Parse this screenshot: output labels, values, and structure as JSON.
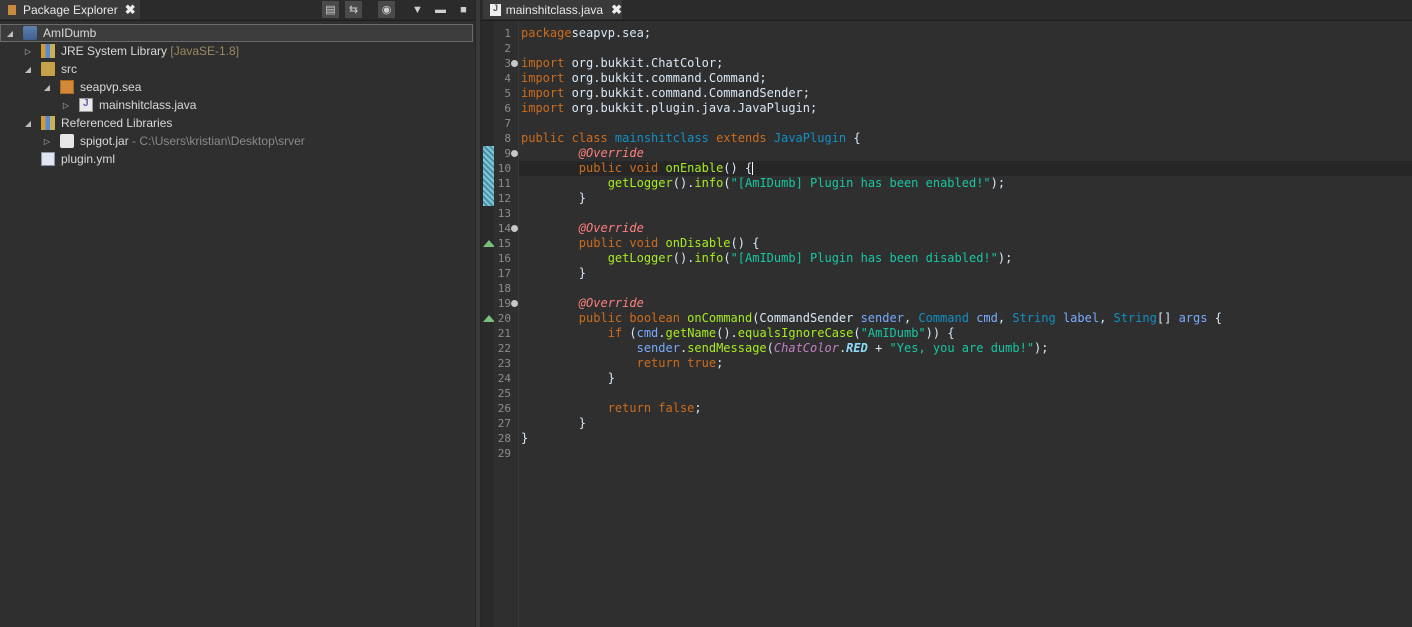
{
  "explorer": {
    "tab_title": "Package Explorer",
    "close": "✖",
    "toolbar": [
      "collapse-all",
      "link-with-editor",
      "focus-working-set",
      "view-menu",
      "minimize",
      "maximize"
    ],
    "tree": [
      {
        "label": "AmIDumb",
        "extra": "",
        "icon": "java-project-icon",
        "depth": 0,
        "expanded": true,
        "selected": true
      },
      {
        "label": "JRE System Library",
        "extra": "[JavaSE-1.8]",
        "icon": "library-icon",
        "depth": 1,
        "expanded": false
      },
      {
        "label": "src",
        "extra": "",
        "icon": "source-folder-icon",
        "depth": 1,
        "expanded": true
      },
      {
        "label": "seapvp.sea",
        "extra": "",
        "icon": "package-icon",
        "depth": 2,
        "expanded": true
      },
      {
        "label": "mainshitclass.java",
        "extra": "",
        "icon": "java-file-icon",
        "depth": 3,
        "expanded": false
      },
      {
        "label": "Referenced Libraries",
        "extra": "",
        "icon": "library-icon",
        "depth": 1,
        "expanded": true
      },
      {
        "label": "spigot.jar",
        "extra": "- C:\\Users\\kristian\\Desktop\\srver",
        "icon": "jar-icon",
        "depth": 2,
        "expanded": false
      },
      {
        "label": "plugin.yml",
        "extra": "",
        "icon": "yml-file-icon",
        "depth": 1,
        "expanded": null
      }
    ]
  },
  "editor": {
    "tab_title": "mainshitclass.java",
    "close": "✖",
    "line_numbers": [
      "1",
      "2",
      "3",
      "4",
      "5",
      "6",
      "7",
      "8",
      "9",
      "10",
      "11",
      "12",
      "13",
      "14",
      "15",
      "16",
      "17",
      "18",
      "19",
      "20",
      "21",
      "22",
      "23",
      "24",
      "25",
      "26",
      "27",
      "28",
      "29"
    ],
    "lines": [
      [
        [
          "kw",
          "package"
        ],
        [
          "",
          "seapvp.sea;"
        ]
      ],
      [],
      [
        [
          "kw",
          "import"
        ],
        [
          "",
          " org.bukkit.ChatColor;"
        ]
      ],
      [
        [
          "kw",
          "import"
        ],
        [
          "",
          " org.bukkit.command.Command;"
        ]
      ],
      [
        [
          "kw",
          "import"
        ],
        [
          "",
          " org.bukkit.command.CommandSender;"
        ]
      ],
      [
        [
          "kw",
          "import"
        ],
        [
          "",
          " org.bukkit.plugin.java.JavaPlugin;"
        ]
      ],
      [],
      [
        [
          "kw",
          "public class "
        ],
        [
          "ty",
          "mainshitclass"
        ],
        [
          "kw",
          " extends "
        ],
        [
          "ty",
          "JavaPlugin"
        ],
        [
          "",
          " {"
        ]
      ],
      [
        [
          "",
          "        "
        ],
        [
          "an",
          "@Override"
        ]
      ],
      [
        [
          "",
          "        "
        ],
        [
          "kw",
          "public void "
        ],
        [
          "fn",
          "onEnable"
        ],
        [
          "",
          "() {"
        ]
      ],
      [
        [
          "",
          "            "
        ],
        [
          "fn",
          "getLogger"
        ],
        [
          "",
          "()."
        ],
        [
          "fn",
          "info"
        ],
        [
          "",
          "("
        ],
        [
          "str",
          "\"[AmIDumb] Plugin has been enabled!\""
        ],
        [
          "",
          ");"
        ]
      ],
      [
        [
          "",
          "        }"
        ]
      ],
      [],
      [
        [
          "",
          "        "
        ],
        [
          "an",
          "@Override"
        ]
      ],
      [
        [
          "",
          "        "
        ],
        [
          "kw",
          "public void "
        ],
        [
          "fn",
          "onDisable"
        ],
        [
          "",
          "() {"
        ]
      ],
      [
        [
          "",
          "            "
        ],
        [
          "fn",
          "getLogger"
        ],
        [
          "",
          "()."
        ],
        [
          "fn",
          "info"
        ],
        [
          "",
          "("
        ],
        [
          "str",
          "\"[AmIDumb] Plugin has been disabled!\""
        ],
        [
          "",
          ");"
        ]
      ],
      [
        [
          "",
          "        }"
        ]
      ],
      [],
      [
        [
          "",
          "        "
        ],
        [
          "an",
          "@Override"
        ]
      ],
      [
        [
          "",
          "        "
        ],
        [
          "kw",
          "public boolean "
        ],
        [
          "fn",
          "onCommand"
        ],
        [
          "",
          "(CommandSender "
        ],
        [
          "pa",
          "sender"
        ],
        [
          "",
          ", "
        ],
        [
          "ty",
          "Command"
        ],
        [
          "",
          " "
        ],
        [
          "pa",
          "cmd"
        ],
        [
          "",
          ", "
        ],
        [
          "ty",
          "String"
        ],
        [
          "",
          " "
        ],
        [
          "pa",
          "label"
        ],
        [
          "",
          ", "
        ],
        [
          "ty",
          "String"
        ],
        [
          "",
          "[] "
        ],
        [
          "pa",
          "args"
        ],
        [
          "",
          " {"
        ]
      ],
      [
        [
          "",
          "            "
        ],
        [
          "kw",
          "if"
        ],
        [
          "",
          " ("
        ],
        [
          "pa",
          "cmd"
        ],
        [
          "",
          "."
        ],
        [
          "fn",
          "getName"
        ],
        [
          "",
          "()."
        ],
        [
          "fn",
          "equalsIgnoreCase"
        ],
        [
          "",
          "("
        ],
        [
          "str",
          "\"AmIDumb\""
        ],
        [
          "",
          ")) {"
        ]
      ],
      [
        [
          "",
          "                "
        ],
        [
          "pa",
          "sender"
        ],
        [
          "",
          "."
        ],
        [
          "fn",
          "sendMessage"
        ],
        [
          "",
          "("
        ],
        [
          "cc",
          "ChatColor"
        ],
        [
          "",
          "."
        ],
        [
          "cn",
          "RED"
        ],
        [
          "",
          " + "
        ],
        [
          "str",
          "\"Yes, you are dumb!\""
        ],
        [
          "",
          ");"
        ]
      ],
      [
        [
          "",
          "                "
        ],
        [
          "kw",
          "return true"
        ],
        [
          "",
          ";"
        ]
      ],
      [
        [
          "",
          "            }"
        ]
      ],
      [],
      [
        [
          "",
          "            "
        ],
        [
          "kw",
          "return false"
        ],
        [
          "",
          ";"
        ]
      ],
      [
        [
          "",
          "        }"
        ]
      ],
      [
        [
          "",
          "}"
        ]
      ],
      []
    ],
    "fold_lines": [
      3,
      9,
      14,
      19
    ],
    "override_lines": [
      10,
      15,
      20
    ],
    "current_line": 10
  }
}
